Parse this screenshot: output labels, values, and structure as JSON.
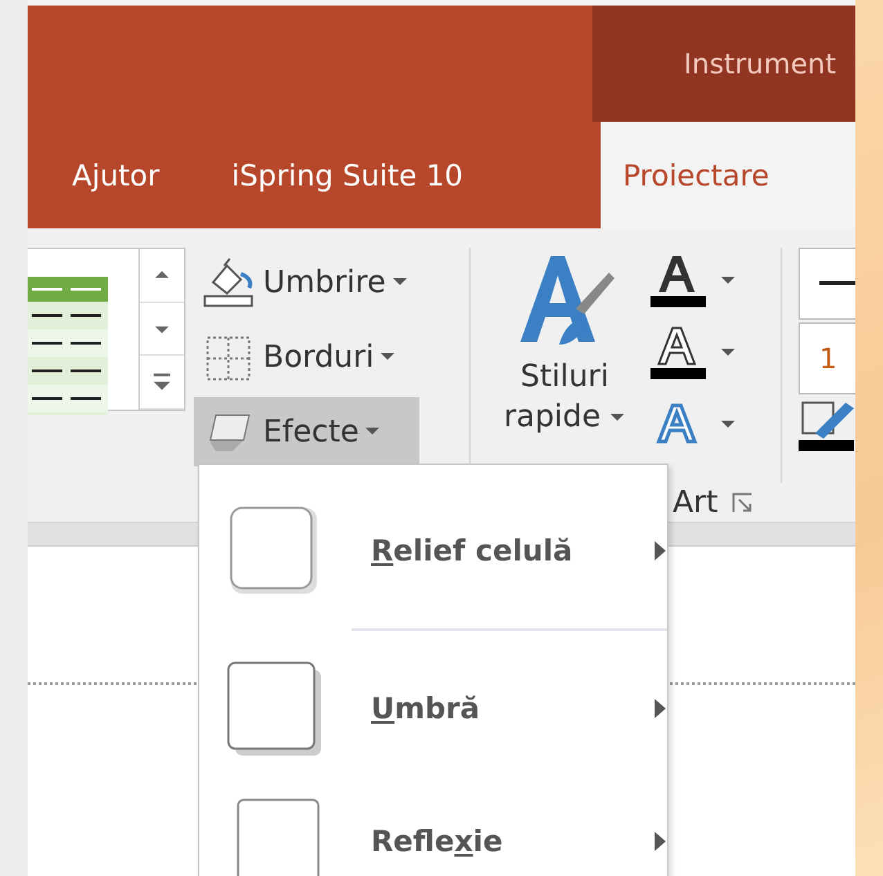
{
  "context_tab_group": {
    "title": "Instrument"
  },
  "tabs": [
    {
      "label": "Ajutor",
      "selected": false
    },
    {
      "label": "iSpring Suite 10",
      "selected": false
    },
    {
      "label": "Proiectare",
      "selected": true
    }
  ],
  "ribbon": {
    "commands": [
      {
        "kind": "shading",
        "label": "Umbrire",
        "highlighted": false
      },
      {
        "kind": "borders",
        "label": "Borduri",
        "highlighted": false
      },
      {
        "kind": "effects",
        "label": "Efecte",
        "highlighted": true
      }
    ],
    "quick_styles": {
      "label_lines": [
        "Stiluri",
        "rapide"
      ]
    },
    "wordart_group": {
      "label": "Art"
    },
    "pen_weight": "1"
  },
  "effects_menu": {
    "items": [
      {
        "kind": "bevel",
        "key": "R",
        "after": "elief celulă",
        "separated": false
      },
      {
        "kind": "shadow",
        "key": "U",
        "after": "mbră",
        "separated": true
      },
      {
        "kind": "reflection",
        "before": "Refle",
        "key": "x",
        "after": "ie",
        "separated": false
      }
    ]
  }
}
